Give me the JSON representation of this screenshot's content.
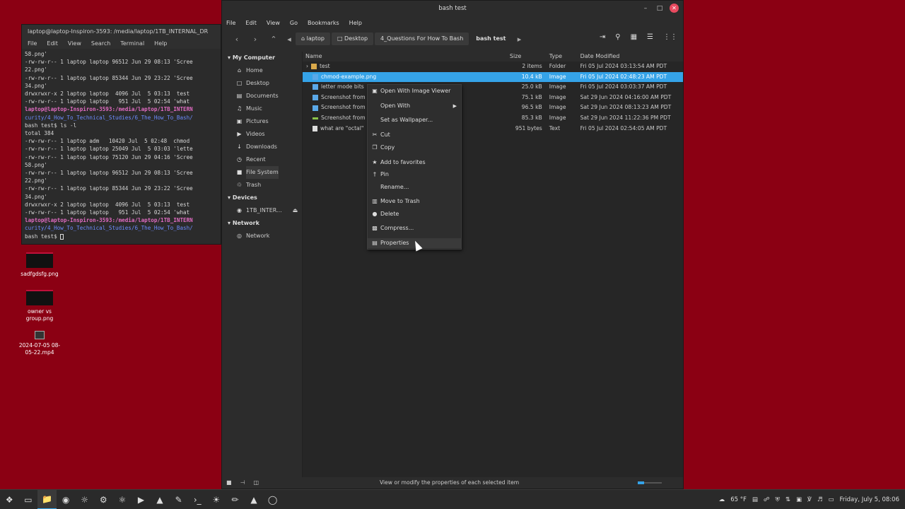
{
  "desktop": {
    "icons": [
      {
        "label": "sadfgdsfg.png",
        "icon": "image-thumbnail-icon"
      },
      {
        "label": "owner vs group.png",
        "icon": "image-thumbnail-icon"
      },
      {
        "label": "2024-07-05 08-05-22.mp4",
        "icon": "video-file-icon"
      }
    ]
  },
  "terminal": {
    "title": "laptop@laptop-Inspiron-3593: /media/laptop/1TB_INTERNAL_DR",
    "menu": [
      "File",
      "Edit",
      "View",
      "Search",
      "Terminal",
      "Help"
    ],
    "lines": [
      "58.png'",
      "-rw-rw-r-- 1 laptop laptop 96512 Jun 29 08:13 'Scree",
      "22.png'",
      "-rw-rw-r-- 1 laptop laptop 85344 Jun 29 23:22 'Scree",
      "34.png'",
      "drwxrwxr-x 2 laptop laptop  4096 Jul  5 03:13  test",
      "-rw-rw-r-- 1 laptop laptop   951 Jul  5 02:54 'what",
      "laptop@laptop-Inspiron-3593:/media/laptop/1TB_INTERN",
      "curity/4_How_To_Technical_Studies/6_The_How_To_Bash/",
      "bash test$ ls -l",
      "total 384",
      "-rw-rw-r-- 1 laptop adm   10420 Jul  5 02:48  chmod",
      "-rw-rw-r-- 1 laptop laptop 25049 Jul  5 03:03 'lette",
      "-rw-rw-r-- 1 laptop laptop 75120 Jun 29 04:16 'Scree",
      "58.png'",
      "-rw-rw-r-- 1 laptop laptop 96512 Jun 29 08:13 'Scree",
      "22.png'",
      "-rw-rw-r-- 1 laptop laptop 85344 Jun 29 23:22 'Scree",
      "34.png'",
      "drwxrwxr-x 2 laptop laptop  4096 Jul  5 03:13  test",
      "-rw-rw-r-- 1 laptop laptop   951 Jul  5 02:54 'what",
      "laptop@laptop-Inspiron-3593:/media/laptop/1TB_INTERN",
      "curity/4_How_To_Technical_Studies/6_The_How_To_Bash/",
      "bash test$ "
    ]
  },
  "file_manager": {
    "title": "bash test",
    "menu": [
      "File",
      "Edit",
      "View",
      "Go",
      "Bookmarks",
      "Help"
    ],
    "breadcrumbs": [
      "laptop",
      "Desktop",
      "4_Questions For How To Bash",
      "bash test"
    ],
    "sidebar": {
      "my_computer": "My Computer",
      "items": [
        {
          "label": "Home",
          "icon": "home-icon"
        },
        {
          "label": "Desktop",
          "icon": "desktop-icon"
        },
        {
          "label": "Documents",
          "icon": "documents-icon"
        },
        {
          "label": "Music",
          "icon": "music-icon"
        },
        {
          "label": "Pictures",
          "icon": "pictures-icon"
        },
        {
          "label": "Videos",
          "icon": "videos-icon"
        },
        {
          "label": "Downloads",
          "icon": "downloads-icon"
        },
        {
          "label": "Recent",
          "icon": "recent-icon"
        },
        {
          "label": "File System",
          "icon": "filesystem-icon"
        },
        {
          "label": "Trash",
          "icon": "trash-icon"
        }
      ],
      "devices": "Devices",
      "device_items": [
        {
          "label": "1TB_INTER...",
          "icon": "drive-icon"
        }
      ],
      "network": "Network",
      "network_items": [
        {
          "label": "Network",
          "icon": "network-icon"
        }
      ]
    },
    "columns": {
      "name": "Name",
      "size": "Size",
      "type": "Type",
      "date": "Date Modified"
    },
    "files": [
      {
        "name": "test",
        "size": "2 items",
        "type": "Folder",
        "date": "Fri 05 Jul 2024 03:13:54 AM PDT",
        "kind": "folder"
      },
      {
        "name": "chmod-example.png",
        "size": "10.4 kB",
        "type": "Image",
        "date": "Fri 05 Jul 2024 02:48:23 AM PDT",
        "kind": "image"
      },
      {
        "name": "letter mode bits",
        "size": "25.0 kB",
        "type": "Image",
        "date": "Fri 05 Jul 2024 03:03:37 AM PDT",
        "kind": "image"
      },
      {
        "name": "Screenshot from",
        "size": "75.1 kB",
        "type": "Image",
        "date": "Sat 29 Jun 2024 04:16:00 AM PDT",
        "kind": "image"
      },
      {
        "name": "Screenshot from",
        "size": "96.5 kB",
        "type": "Image",
        "date": "Sat 29 Jun 2024 08:13:23 AM PDT",
        "kind": "image"
      },
      {
        "name": "Screenshot from",
        "size": "85.3 kB",
        "type": "Image",
        "date": "Sat 29 Jun 2024 11:22:36 PM PDT",
        "kind": "green"
      },
      {
        "name": "what are \"octal\"",
        "size": "951 bytes",
        "type": "Text",
        "date": "Fri 05 Jul 2024 02:54:05 AM PDT",
        "kind": "text"
      }
    ],
    "status": "View or modify the properties of each selected item",
    "zoom_level": 0.25
  },
  "context_menu": {
    "items": [
      {
        "label": "Open With Image Viewer",
        "icon": "image-viewer-icon"
      },
      {
        "label": "Open With",
        "icon": "",
        "submenu": true
      },
      {
        "label": "Set as Wallpaper...",
        "icon": ""
      },
      {
        "label": "Cut",
        "icon": "scissors-icon"
      },
      {
        "label": "Copy",
        "icon": "copy-icon"
      },
      {
        "label": "Add to favorites",
        "icon": "star-icon"
      },
      {
        "label": "Pin",
        "icon": "pin-icon"
      },
      {
        "label": "Rename...",
        "icon": ""
      },
      {
        "label": "Move to Trash",
        "icon": "trash-icon"
      },
      {
        "label": "Delete",
        "icon": "delete-icon"
      },
      {
        "label": "Compress...",
        "icon": "compress-icon"
      },
      {
        "label": "Properties",
        "icon": "properties-icon"
      }
    ]
  },
  "taskbar": {
    "temperature": "65 °F",
    "clock": "Friday, July 5, 08:06"
  }
}
